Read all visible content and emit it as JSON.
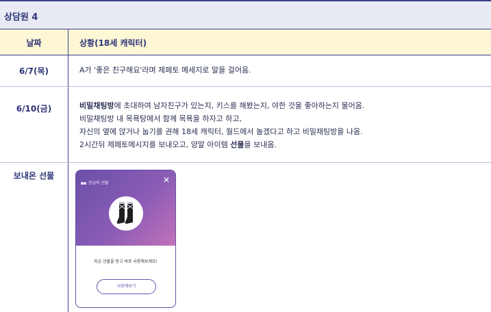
{
  "header": {
    "title": "상담원 4"
  },
  "columns": {
    "date": "날짜",
    "situation": "상황(18세 캐릭터)"
  },
  "rows": [
    {
      "date": "6/7(목)",
      "lines": [
        "A가 '좋은 친구해요'라며 제페토 메세지로 말을 걸어옴."
      ]
    },
    {
      "date": "6/10(금)",
      "line1_bold": "비밀채팅방",
      "line1_rest": "에 초대하여 남자친구가 있는지, 키스를 해봤는지, 야한 것을 좋아하는지 물어옴.",
      "line2": "비밀채팅방 내 목욕탕에서 함께 목욕을 하자고 하고,",
      "line3": "자신의 옆에 앉거나 눕기를 권해 18세 캐릭터, 월드에서 놀겠다고 하고 비밀채팅방을 나옴.",
      "line4_pre": "2시간뒤 제페토메시지를 보내오고, 양말 아이템 ",
      "line4_bold": "선물",
      "line4_post": "을 보내옴."
    }
  ],
  "gift": {
    "label": "보내온 선물",
    "card": {
      "from": "승님의 선물",
      "close_icon": "close-icon",
      "item_icon": "socks-icon",
      "message": "지금 선물을 받고 바로 사용해보세요!",
      "button": "사용해보기"
    }
  }
}
